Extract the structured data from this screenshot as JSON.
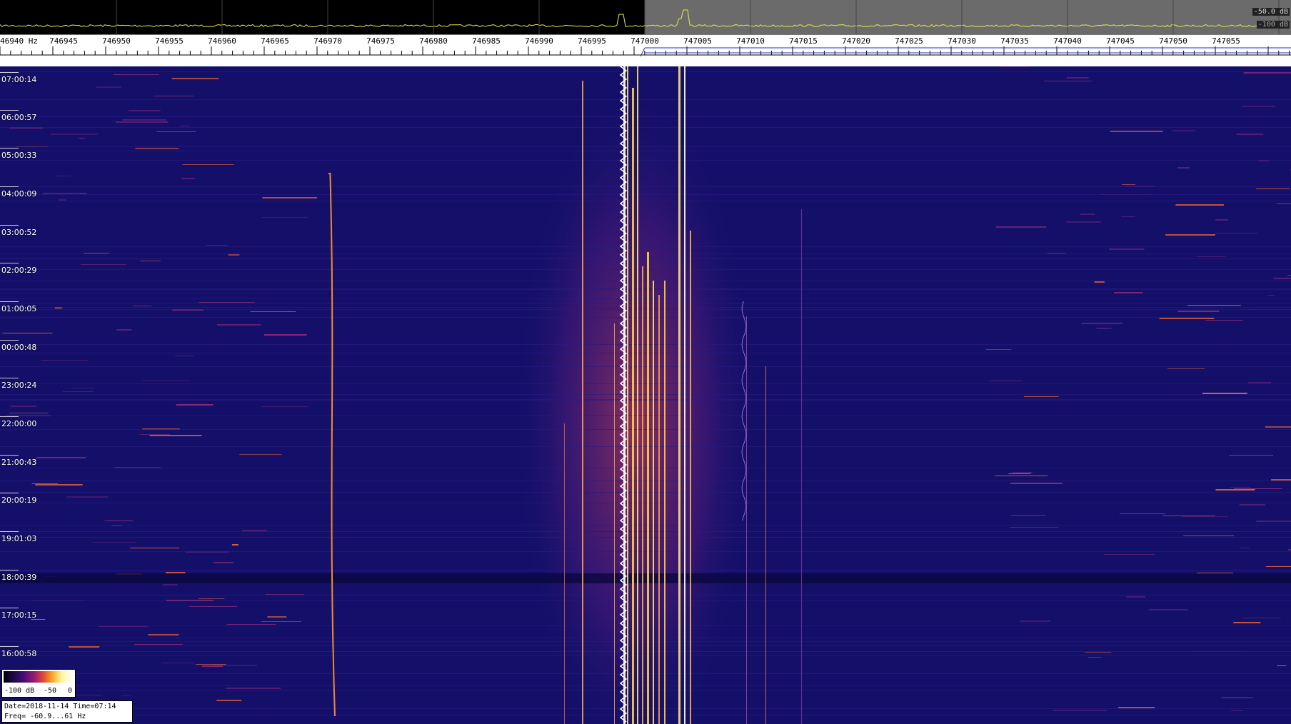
{
  "spectrum": {
    "db_top": "-50.0 dB",
    "db_bottom": "-100 dB",
    "trace_color": "#e8e84a",
    "highlight_color": "#6b6b6b"
  },
  "frequency_scale": {
    "first_label": "46940 Hz",
    "labels": [
      "746945",
      "746950",
      "746955",
      "746960",
      "746965",
      "746970",
      "746975",
      "746980",
      "746985",
      "746990",
      "746995",
      "747000",
      "747005",
      "747010",
      "747015",
      "747020",
      "747025",
      "747030",
      "747035",
      "747040",
      "747045",
      "747050",
      "747055"
    ]
  },
  "time_labels": [
    "07:00:14",
    "06:00:57",
    "05:00:33",
    "04:00:09",
    "03:00:52",
    "02:00:29",
    "01:00:05",
    "00:00:48",
    "23:00:24",
    "22:00:00",
    "21:00:43",
    "20:00:19",
    "19:01:03",
    "18:00:39",
    "17:00:15",
    "16:00:58"
  ],
  "colorbar": {
    "labels": [
      "-100 dB",
      "-50",
      "0"
    ]
  },
  "info": {
    "line1": "Date=2018-11-14 Time=07:14",
    "line2": "Freq= -60.9...61 Hz"
  },
  "colors": {
    "background": "#14106a",
    "signal_hot": "#ffe070",
    "signal_warm": "#f08a30"
  }
}
